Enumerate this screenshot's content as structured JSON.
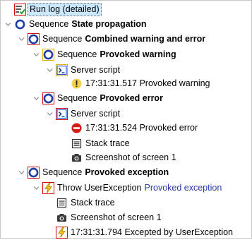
{
  "tree": [
    {
      "expander": "none",
      "icon": "run-log-icon",
      "border": "red",
      "label": "Run log (detailed)",
      "selected": true,
      "name": "node-run-log"
    },
    {
      "expander": "expanded",
      "icon": "sequence-icon",
      "border": "none",
      "kind": "Sequence",
      "label": "State propagation",
      "bold": true,
      "name": "node-sequence-state-propagation"
    },
    {
      "expander": "expanded",
      "icon": "sequence-icon",
      "border": "red",
      "kind": "Sequence",
      "label": "Combined warning and error",
      "bold": true,
      "name": "node-sequence-combined-warning-error"
    },
    {
      "expander": "expanded",
      "icon": "sequence-icon",
      "border": "yellow",
      "kind": "Sequence",
      "label": "Provoked warning",
      "bold": true,
      "name": "node-sequence-provoked-warning"
    },
    {
      "expander": "expanded",
      "icon": "server-script-icon",
      "border": "yellow",
      "label": "Server script",
      "name": "node-server-script-warning"
    },
    {
      "expander": "none",
      "icon": "warning-icon",
      "border": "none",
      "label": "17:31:31.517 Provoked warning",
      "name": "node-provoked-warning-message"
    },
    {
      "expander": "expanded",
      "icon": "sequence-icon",
      "border": "red",
      "kind": "Sequence",
      "label": "Provoked error",
      "bold": true,
      "name": "node-sequence-provoked-error"
    },
    {
      "expander": "expanded",
      "icon": "server-script-icon",
      "border": "red",
      "label": "Server script",
      "name": "node-server-script-error"
    },
    {
      "expander": "none",
      "icon": "error-icon",
      "border": "none",
      "label": "17:31:31.524 Provoked error",
      "name": "node-provoked-error-message"
    },
    {
      "expander": "none",
      "icon": "stack-trace-icon",
      "border": "none",
      "label": "Stack trace",
      "name": "node-stack-trace-1"
    },
    {
      "expander": "none",
      "icon": "camera-icon",
      "border": "none",
      "label": "Screenshot of screen 1",
      "name": "node-screenshot-1"
    },
    {
      "expander": "expanded",
      "icon": "sequence-icon",
      "border": "red",
      "kind": "Sequence",
      "label": "Provoked exception",
      "bold": true,
      "name": "node-sequence-provoked-exception"
    },
    {
      "expander": "expanded",
      "icon": "throw-exception-icon",
      "border": "red",
      "label": "Throw UserException",
      "link": "Provoked exception",
      "name": "node-throw-user-exception"
    },
    {
      "expander": "none",
      "icon": "stack-trace-icon",
      "border": "none",
      "label": "Stack trace",
      "name": "node-stack-trace-2"
    },
    {
      "expander": "none",
      "icon": "camera-icon",
      "border": "none",
      "label": "Screenshot of screen 1",
      "name": "node-screenshot-2"
    },
    {
      "expander": "none",
      "icon": "exception-icon",
      "border": "red",
      "label": "17:31:31.794 Excepted by UserException",
      "name": "node-excepted-message"
    }
  ],
  "colors": {
    "error_border": "#d01010",
    "warning_border": "#e0b000",
    "sequence_ring": "#1f3fa8",
    "script_accent": "#2a5fd0",
    "selection": "#cce8ff",
    "link": "#2a3aa8"
  }
}
